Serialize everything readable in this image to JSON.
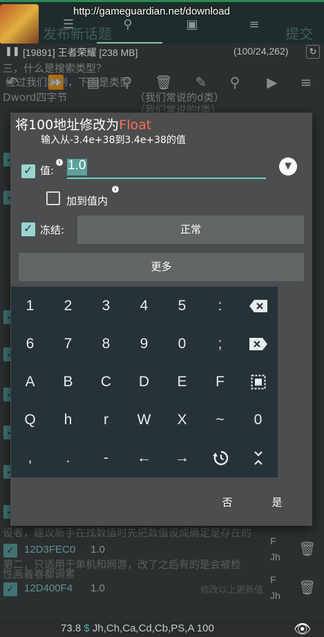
{
  "background": {
    "url_overlay": "http://gameguardian.net/download",
    "title_dim": "发布新话题",
    "title_dim_right": "提交",
    "process_line": "[19891] 王者荣耀 [238 MB]",
    "process_count": "(100/24,262)",
    "text_lines": [
      "三，什么是搜索类型？",
      "经过我们跑到，下面是类型",
      "Dword四字节",
      "（我们常说的d类）",
      "（我们常说的f类）",
      "设者，建议新手在找数值时先把数值设成确定是存在的",
      "第二，只适用于单机和网游，改了之后有的是会被检",
      "性画着卷都调累"
    ],
    "rows": [
      {
        "address": "12D3FEC0",
        "value": "1.0",
        "type": "F",
        "type2": "Jh"
      },
      {
        "address": "12D400F4",
        "value": "1.0",
        "type": "F",
        "type2": "Jh"
      }
    ],
    "row_hint": "修改以上更新值",
    "status": {
      "prefix": "73.8",
      "dollar": "$",
      "text": "Jh,Ch,Ca,Cd,Cb,PS,A 100"
    }
  },
  "dialog": {
    "title_prefix": "将100地址修改为",
    "title_type": "Float",
    "subtitle": "输入从-3.4e+38到3.4e+38的值",
    "value_label": "值:",
    "value": "1.0",
    "add_to_value_label": "加到值内",
    "add_to_value_checked": false,
    "value_checked": true,
    "freeze_label": "冻结:",
    "freeze_checked": true,
    "freeze_mode": "正常",
    "more_label": "更多",
    "no_label": "否",
    "yes_label": "是"
  },
  "keyboard": {
    "rows": [
      [
        "1",
        "2",
        "3",
        "4",
        "5",
        ":",
        "backspace-icon"
      ],
      [
        "6",
        "7",
        "8",
        "9",
        "0",
        ";",
        "delete-icon"
      ],
      [
        "A",
        "B",
        "C",
        "D",
        "E",
        "F",
        "select-all-icon"
      ],
      [
        "Q",
        "h",
        "r",
        "W",
        "X",
        "~",
        "0"
      ],
      [
        ",",
        ".",
        "-",
        "←",
        "→",
        "history-icon",
        "collapse-icon"
      ]
    ]
  }
}
